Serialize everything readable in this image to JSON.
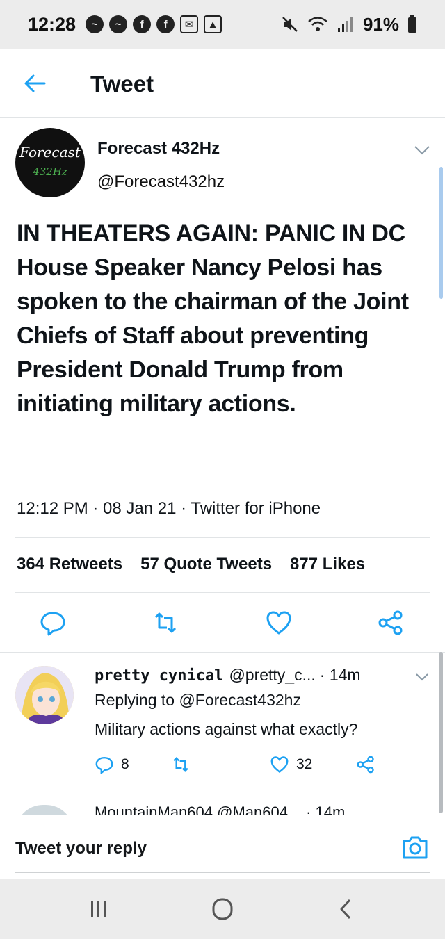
{
  "status_bar": {
    "time": "12:28",
    "battery": "91%"
  },
  "header": {
    "title": "Tweet"
  },
  "tweet": {
    "author_name": "Forecast 432Hz",
    "author_handle": "@Forecast432hz",
    "avatar_text_line1": "Forecast",
    "avatar_text_line2": "432Hz",
    "text": "IN THEATERS AGAIN: PANIC IN DC\nHouse Speaker Nancy Pelosi has spoken to the chairman of the Joint Chiefs of Staff about preventing President Donald Trump from initiating military actions.",
    "meta": "12:12 PM · 08 Jan 21 · Twitter for iPhone",
    "stats": {
      "retweets_count": "364",
      "retweets_label": "Retweets",
      "quotes_count": "57",
      "quotes_label": "Quote Tweets",
      "likes_count": "877",
      "likes_label": "Likes"
    }
  },
  "reply": {
    "name": "pretty cynical",
    "handle": "@pretty_c...",
    "time": "· 14m",
    "replying_to": "Replying to @Forecast432hz",
    "text": "Military actions against what exactly?",
    "reply_count": "8",
    "like_count": "32"
  },
  "next_reply": {
    "name": "MountainMan604",
    "handle": "@Man604",
    "time": "· 14m"
  },
  "composer": {
    "placeholder": "Tweet your reply"
  },
  "colors": {
    "accent": "#1da1f2",
    "icon_gray": "#657786",
    "divider": "#e1e4e6"
  }
}
